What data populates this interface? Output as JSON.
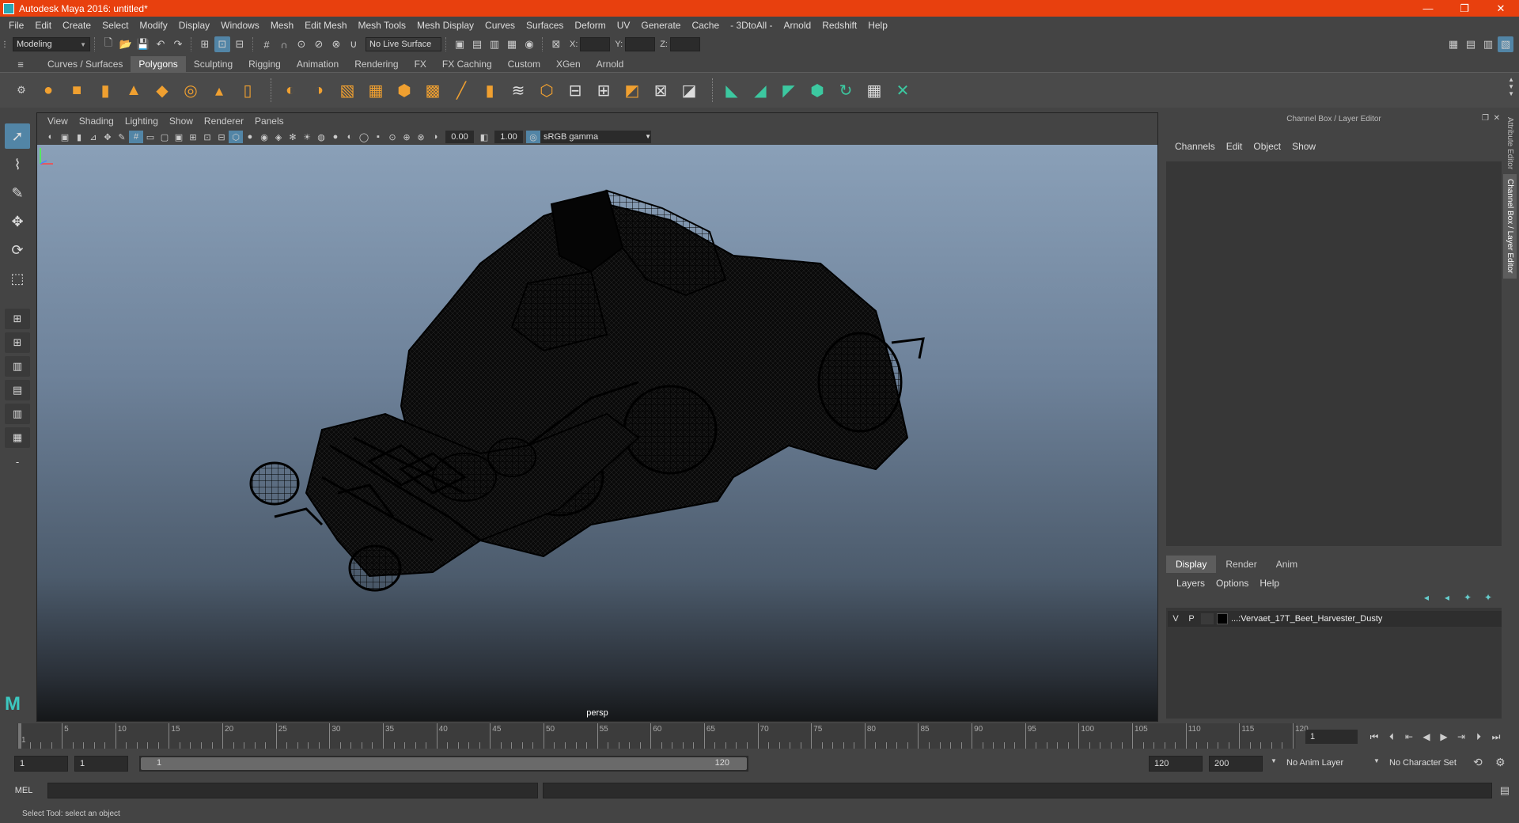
{
  "window": {
    "title": "Autodesk Maya 2016: untitled*",
    "minimize": "—",
    "maximize": "❐",
    "close": "✕"
  },
  "menubar": [
    "File",
    "Edit",
    "Create",
    "Select",
    "Modify",
    "Display",
    "Windows",
    "Mesh",
    "Edit Mesh",
    "Mesh Tools",
    "Mesh Display",
    "Curves",
    "Surfaces",
    "Deform",
    "UV",
    "Generate",
    "Cache",
    "- 3DtoAll -",
    "Arnold",
    "Redshift",
    "Help"
  ],
  "statusline": {
    "mode": "Modeling",
    "live_surface": "No Live Surface",
    "x_label": "X:",
    "y_label": "Y:",
    "z_label": "Z:"
  },
  "shelf_tabs": [
    "Curves / Surfaces",
    "Polygons",
    "Sculpting",
    "Rigging",
    "Animation",
    "Rendering",
    "FX",
    "FX Caching",
    "Custom",
    "XGen",
    "Arnold"
  ],
  "shelf_active": "Polygons",
  "viewport": {
    "menu": [
      "View",
      "Shading",
      "Lighting",
      "Show",
      "Renderer",
      "Panels"
    ],
    "exposure": "0.00",
    "gamma": "1.00",
    "color_space": "sRGB gamma",
    "camera": "persp"
  },
  "channel_box": {
    "title": "Channel Box / Layer Editor",
    "menu": [
      "Channels",
      "Edit",
      "Object",
      "Show"
    ]
  },
  "layer_editor": {
    "tabs": [
      "Display",
      "Render",
      "Anim"
    ],
    "active_tab": "Display",
    "menu": [
      "Layers",
      "Options",
      "Help"
    ],
    "layers": [
      {
        "v": "V",
        "p": "P",
        "name": "...:Vervaet_17T_Beet_Harvester_Dusty"
      }
    ]
  },
  "side_tabs": [
    "Attribute Editor",
    "Channel Box / Layer Editor"
  ],
  "timeline": {
    "ticks": [
      1,
      5,
      10,
      15,
      20,
      25,
      30,
      35,
      40,
      45,
      50,
      55,
      60,
      65,
      70,
      75,
      80,
      85,
      90,
      95,
      100,
      105,
      110,
      115,
      120
    ],
    "current_frame": "1"
  },
  "range": {
    "start": "1",
    "playback_start": "1",
    "slider_start": "1",
    "slider_end": "120",
    "playback_end": "120",
    "end": "200",
    "anim_layer": "No Anim Layer",
    "character_set": "No Character Set"
  },
  "command_line": {
    "label": "MEL"
  },
  "help_line": "Select Tool: select an object"
}
